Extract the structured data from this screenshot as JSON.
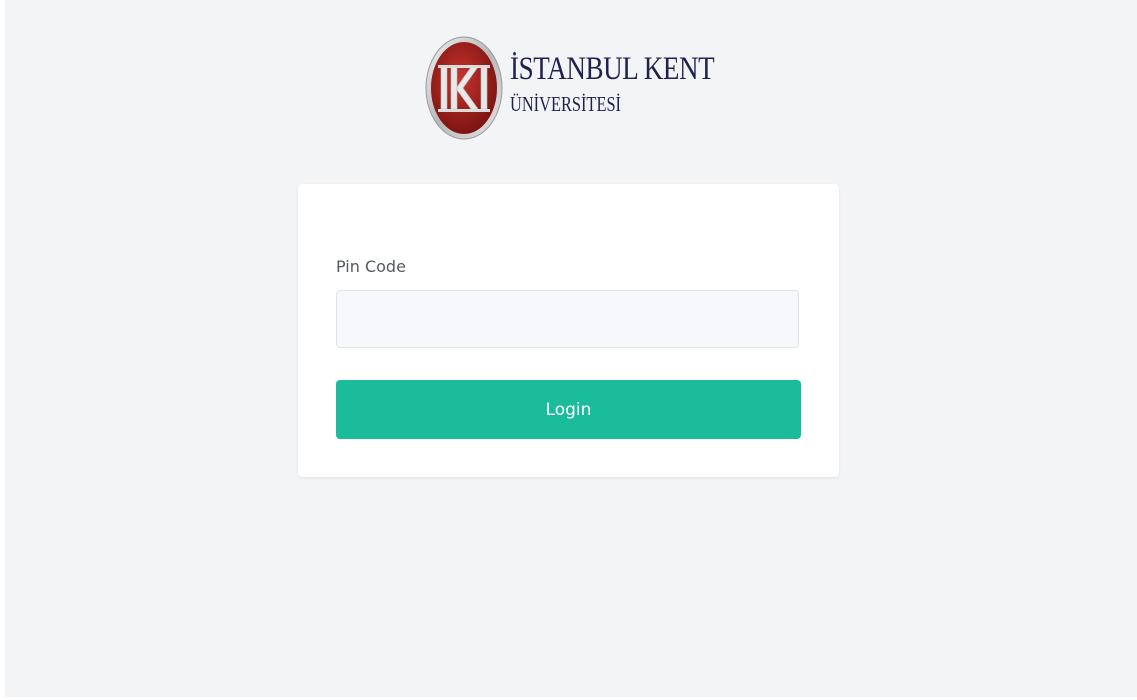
{
  "logo": {
    "emblem_letters": "IKI",
    "name_line1": "İSTANBUL KENT",
    "name_line2": "ÜNİVERSİTESİ",
    "colors": {
      "emblem_red": "#a3231f",
      "emblem_silver": "#cfcfcf",
      "text_navy": "#1f2150"
    }
  },
  "login_form": {
    "pin_label": "Pin Code",
    "pin_value": "",
    "pin_placeholder": "",
    "login_label": "Login"
  },
  "colors": {
    "page_background": "#f3f4f6",
    "card_background": "#ffffff",
    "button_background": "#1abc9c",
    "button_text": "#ffffff",
    "label_text": "#555a61"
  }
}
